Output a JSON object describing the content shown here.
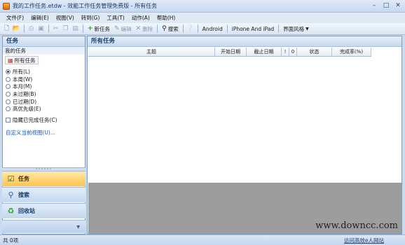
{
  "window": {
    "title": "我的工作任务.etdw - 效能工作任务管理免费版 - 所有任务"
  },
  "menubar": {
    "items": [
      "文件(F)",
      "编辑(E)",
      "视图(V)",
      "转到(G)",
      "工具(T)",
      "动作(A)",
      "帮助(H)"
    ]
  },
  "toolbar": {
    "new_task": "新任务",
    "edit": "编辑",
    "delete": "删除",
    "search": "搜索",
    "android": "Android",
    "iphone_ipad": "iPhone And iPad",
    "skin": "界面风格"
  },
  "left_panel": {
    "title": "任务",
    "section": "我的任务",
    "all_tasks_button": "所有任务",
    "filters": [
      {
        "label": "所有(L)",
        "selected": true
      },
      {
        "label": "本周(W)",
        "selected": false
      },
      {
        "label": "本月(M)",
        "selected": false
      },
      {
        "label": "未过期(B)",
        "selected": false
      },
      {
        "label": "已过期(D)",
        "selected": false
      },
      {
        "label": "高优先级(E)",
        "selected": false
      }
    ],
    "hide_completed": "隐藏已完成任务(C)",
    "custom_view_link": "自定义当前视图(U)..."
  },
  "nav": {
    "tasks": "任务",
    "search": "搜索",
    "recycle": "回收站"
  },
  "main": {
    "title": "所有任务",
    "columns": [
      "主题",
      "开始日期",
      "截止日期",
      "!",
      "0",
      "状态",
      "完成率(%)"
    ]
  },
  "statusbar": {
    "count": "共 0项",
    "link": "访问高效e人网站"
  },
  "watermark": "www.downcc.com"
}
